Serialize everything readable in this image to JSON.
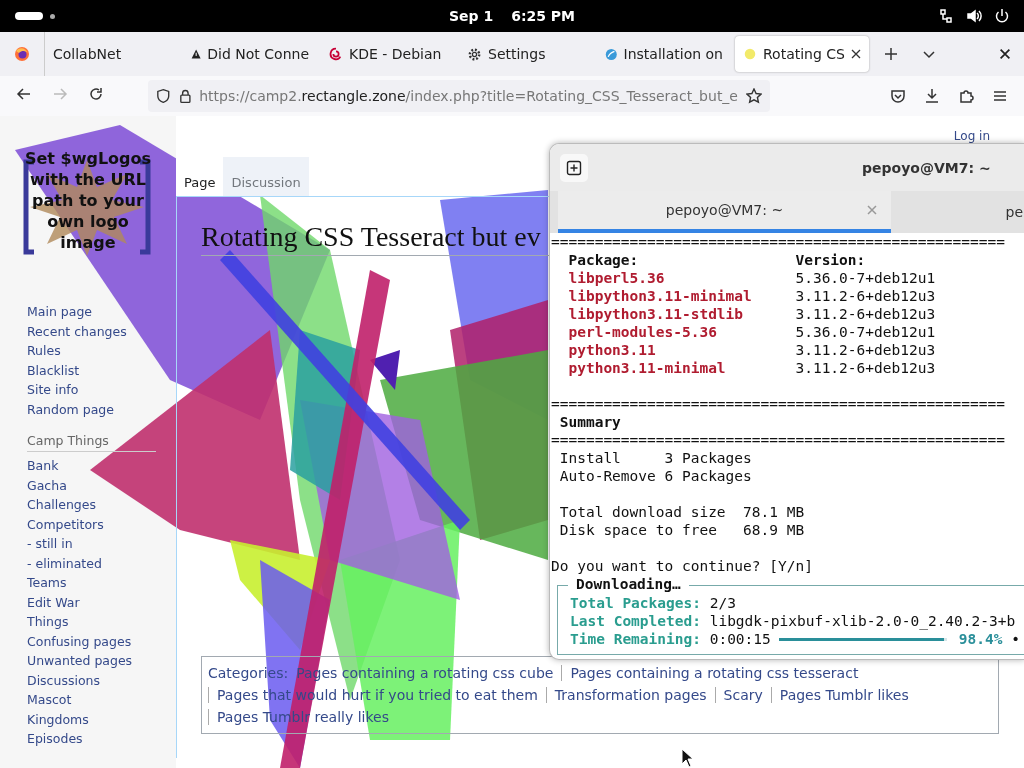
{
  "system_bar": {
    "date": "Sep 1",
    "time": "6:25 PM"
  },
  "browser": {
    "tabs": [
      {
        "label": "CollabNet",
        "kind": "plain",
        "selected": false
      },
      {
        "label": "Did Not Conne",
        "kind": "warning",
        "selected": false
      },
      {
        "label": "KDE - Debian",
        "kind": "swirl",
        "selected": false
      },
      {
        "label": "Settings",
        "kind": "gear",
        "selected": false
      },
      {
        "label": "Installation on",
        "kind": "globe",
        "selected": false
      },
      {
        "label": "Rotating CS",
        "kind": "dot",
        "selected": true
      }
    ],
    "forward_disabled": true,
    "url": {
      "prefix": "https://camp2.",
      "domain": "rectangle.zone",
      "path": "/index.php?title=Rotating_CSS_Tesseract_but_e"
    }
  },
  "wiki": {
    "login": "Log in",
    "logo_text": "Set $wgLogos with the URL path to your own logo image",
    "nav": [
      "Main page",
      "Recent changes",
      "Rules",
      "Blacklist",
      "Site info",
      "Random page"
    ],
    "section": {
      "title": "Camp Things",
      "items": [
        "Bank",
        "Gacha",
        "Challenges",
        "Competitors",
        "- still in",
        "- eliminated",
        "Teams",
        "Edit War",
        "Things",
        "Confusing pages",
        "Unwanted pages",
        "Discussions",
        "Mascot",
        "Kingdoms",
        "Episodes"
      ]
    },
    "tabs": [
      {
        "label": "Page",
        "selected": true
      },
      {
        "label": "Discussion",
        "selected": false
      }
    ],
    "heading": "Rotating CSS Tesseract but ev",
    "categories": {
      "label": "Categories:",
      "items": [
        "Pages containing a rotating css cube",
        "Pages containing a rotating css tesseract",
        "Pages that would hurt if you tried to eat them",
        "Transformation pages",
        "Scary",
        "Pages Tumblr likes",
        "Pages Tumblr really likes"
      ]
    }
  },
  "terminal": {
    "title": "pepoyo@VM7: ~",
    "tabs": [
      {
        "label": "pepoyo@VM7: ~",
        "selected": true
      },
      {
        "label": "pe",
        "selected": false
      }
    ],
    "lines": [
      {
        "kind": "rule",
        "text": "===================================================="
      },
      {
        "kind": "header",
        "cols": [
          "Package:",
          "Version:"
        ]
      },
      {
        "kind": "package",
        "cols": [
          "libperl5.36",
          "5.36.0-7+deb12u1"
        ]
      },
      {
        "kind": "package",
        "cols": [
          "libpython3.11-minimal",
          "3.11.2-6+deb12u3"
        ]
      },
      {
        "kind": "package",
        "cols": [
          "libpython3.11-stdlib",
          "3.11.2-6+deb12u3"
        ]
      },
      {
        "kind": "package",
        "cols": [
          "perl-modules-5.36",
          "5.36.0-7+deb12u1"
        ]
      },
      {
        "kind": "package",
        "cols": [
          "python3.11",
          "3.11.2-6+deb12u3"
        ]
      },
      {
        "kind": "package",
        "cols": [
          "python3.11-minimal",
          "3.11.2-6+deb12u3"
        ]
      },
      {
        "kind": "blank"
      },
      {
        "kind": "rule",
        "text": "===================================================="
      },
      {
        "kind": "bold",
        "text": "Summary"
      },
      {
        "kind": "rule",
        "text": "===================================================="
      },
      {
        "kind": "text",
        "text": "Install     3 Packages"
      },
      {
        "kind": "text",
        "text": "Auto-Remove 6 Packages"
      },
      {
        "kind": "blank"
      },
      {
        "kind": "text",
        "text": "Total download size  78.1 MB"
      },
      {
        "kind": "text",
        "text": "Disk space to free   68.9 MB"
      },
      {
        "kind": "blank"
      },
      {
        "kind": "prompt",
        "text": "Do you want to continue? [Y/n]"
      }
    ],
    "download": {
      "title": "Downloading…",
      "rows": [
        {
          "label": "Total Packages:",
          "value": "2/3"
        },
        {
          "label": "Last Completed:",
          "value": "libgdk-pixbuf-xlib-2.0-0_2.40.2-3+b"
        },
        {
          "label": "Time Remaining:",
          "value": "0:00:15"
        }
      ],
      "level": 0.984,
      "percent": "98.4%",
      "more": "•"
    }
  }
}
